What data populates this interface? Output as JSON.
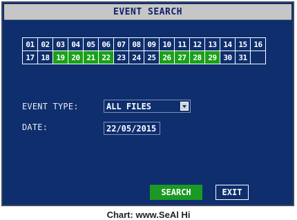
{
  "title": "EVENT SEARCH",
  "calendar": {
    "days": [
      {
        "label": "01",
        "has_events": false
      },
      {
        "label": "02",
        "has_events": false
      },
      {
        "label": "03",
        "has_events": false
      },
      {
        "label": "04",
        "has_events": false
      },
      {
        "label": "05",
        "has_events": false
      },
      {
        "label": "06",
        "has_events": false
      },
      {
        "label": "07",
        "has_events": false
      },
      {
        "label": "08",
        "has_events": false
      },
      {
        "label": "09",
        "has_events": false
      },
      {
        "label": "10",
        "has_events": false
      },
      {
        "label": "11",
        "has_events": false
      },
      {
        "label": "12",
        "has_events": false
      },
      {
        "label": "13",
        "has_events": false
      },
      {
        "label": "14",
        "has_events": false
      },
      {
        "label": "15",
        "has_events": false
      },
      {
        "label": "16",
        "has_events": false
      },
      {
        "label": "17",
        "has_events": false
      },
      {
        "label": "18",
        "has_events": false
      },
      {
        "label": "19",
        "has_events": true
      },
      {
        "label": "20",
        "has_events": true
      },
      {
        "label": "21",
        "has_events": true
      },
      {
        "label": "22",
        "has_events": true
      },
      {
        "label": "23",
        "has_events": false
      },
      {
        "label": "24",
        "has_events": false
      },
      {
        "label": "25",
        "has_events": false
      },
      {
        "label": "26",
        "has_events": true
      },
      {
        "label": "27",
        "has_events": true
      },
      {
        "label": "28",
        "has_events": true
      },
      {
        "label": "29",
        "has_events": true
      },
      {
        "label": "30",
        "has_events": false
      },
      {
        "label": "31",
        "has_events": false
      },
      {
        "label": "",
        "has_events": false
      }
    ],
    "highlight_color": "#1aa11a"
  },
  "event_type": {
    "label": "EVENT TYPE:",
    "value": "ALL FILES"
  },
  "date": {
    "label": "DATE:",
    "value": "22/05/2015"
  },
  "buttons": {
    "search": "SEARCH",
    "exit": "EXIT"
  },
  "colors": {
    "background": "#0e2e6d",
    "title_bar": "#c6c6c6",
    "search_button": "#1a9a24"
  },
  "caption": "Chart: www.SeAl Hi"
}
